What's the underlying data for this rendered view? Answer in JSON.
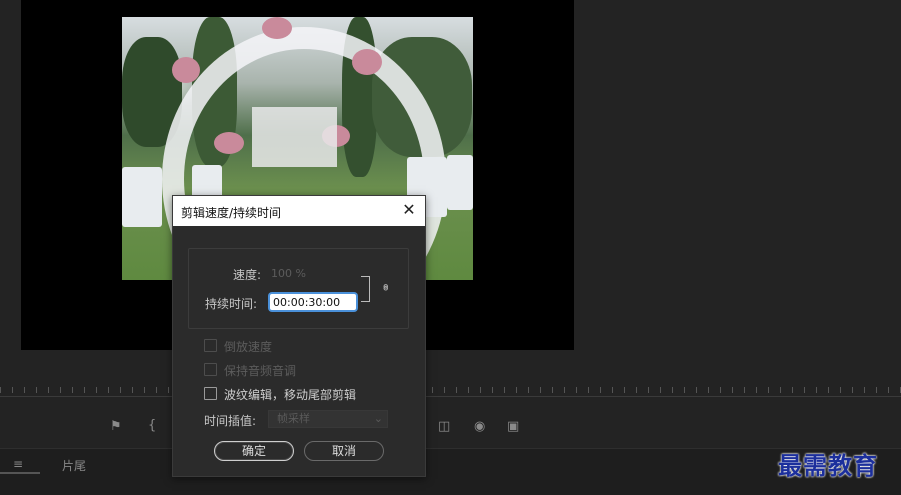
{
  "dialog": {
    "title": "剪辑速度/持续时间",
    "speed_label": "速度:",
    "speed_value": "100 %",
    "duration_label": "持续时间:",
    "duration_value": "00:00:30:00",
    "options": [
      {
        "label": "倒放速度",
        "checked": false,
        "enabled": false
      },
      {
        "label": "保持音频音调",
        "checked": false,
        "enabled": false
      },
      {
        "label": "波纹编辑，移动尾部剪辑",
        "checked": false,
        "enabled": true
      }
    ],
    "interp_label": "时间插值:",
    "interp_value": "帧采样",
    "ok_label": "确定",
    "cancel_label": "取消"
  },
  "bottom_tabs": {
    "left_icon": "≡",
    "tab1": "片尾"
  },
  "watermark": "最需教育",
  "colors": {
    "background": "#232323",
    "dialog_bg": "#2b2b2b",
    "focus_ring": "#4a90d9",
    "watermark": "#1c2f9c"
  }
}
